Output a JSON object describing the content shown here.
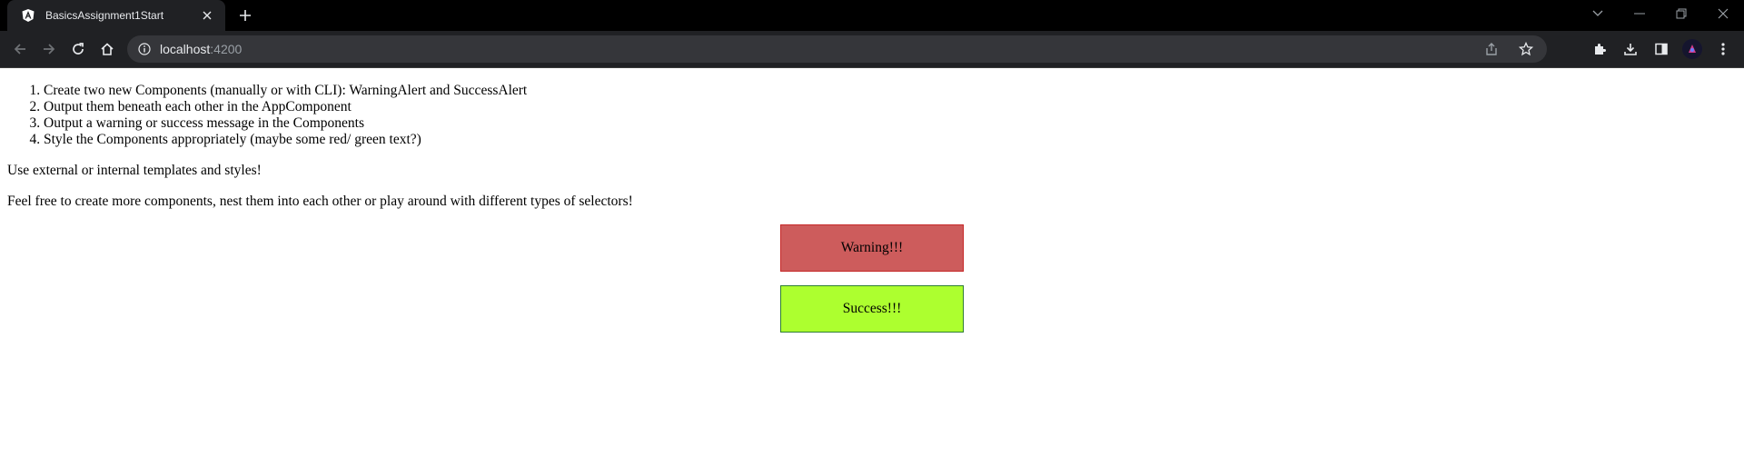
{
  "browser": {
    "tab": {
      "title": "BasicsAssignment1Start",
      "close_glyph": "✕"
    },
    "new_tab_glyph": "+",
    "url": {
      "host": "localhost",
      "port": ":4200"
    }
  },
  "content": {
    "instructions": [
      "Create two new Components (manually or with CLI): WarningAlert and SuccessAlert",
      "Output them beneath each other in the AppComponent",
      "Output a warning or success message in the Components",
      "Style the Components appropriately (maybe some red/ green text?)"
    ],
    "note1": "Use external or internal templates and styles!",
    "note2": "Feel free to create more components, nest them into each other or play around with different types of selectors!",
    "warning_text": "Warning!!!",
    "success_text": "Success!!!"
  },
  "colors": {
    "warning_bg": "#cd5c5c",
    "success_bg": "#adff2f"
  },
  "icons": [
    "angular-icon",
    "close-icon",
    "plus-icon",
    "back-icon",
    "forward-icon",
    "reload-icon",
    "home-icon",
    "info-icon",
    "share-icon",
    "star-icon",
    "extensions-icon",
    "download-icon",
    "side-panel-icon",
    "avatar",
    "menu-icon"
  ]
}
